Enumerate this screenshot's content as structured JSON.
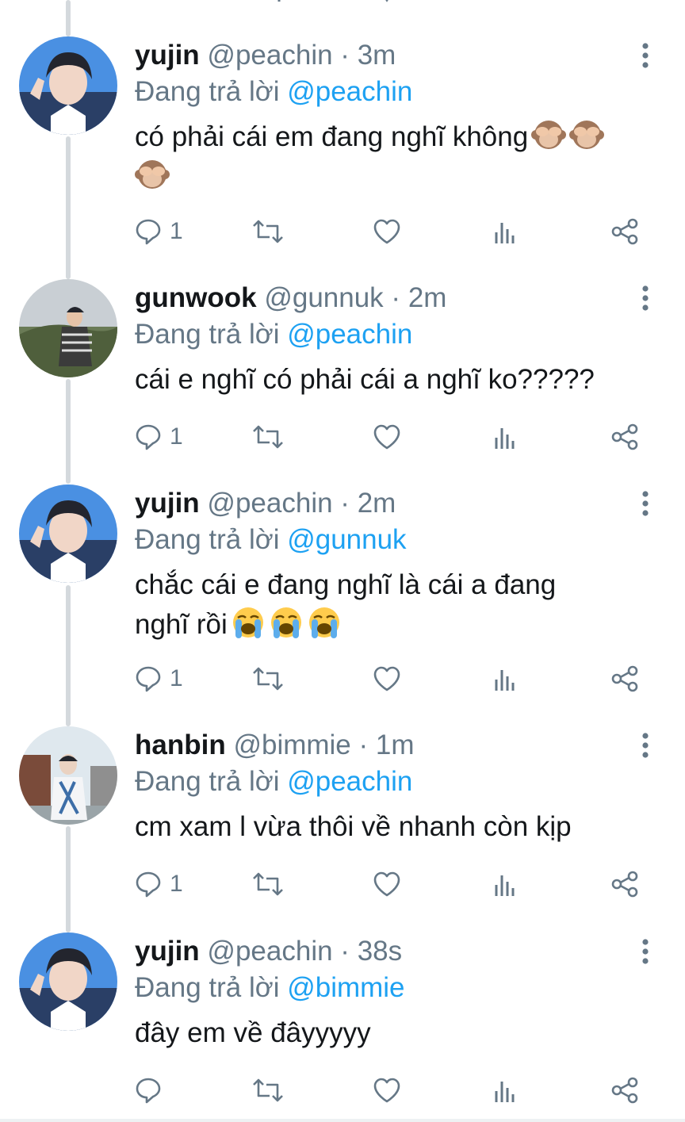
{
  "tweets": [
    {
      "name": "yujin",
      "handle": "@peachin",
      "sep": "·",
      "time": "3m",
      "reply_prefix": "Đang trả lời",
      "reply_to": "@peachin",
      "text": "có phải cái em đang nghĩ không",
      "emoji": [
        "see-no-evil-monkey",
        "see-no-evil-monkey",
        "see-no-evil-monkey"
      ],
      "reply_count": "1"
    },
    {
      "name": "gunwook",
      "handle": "@gunnuk",
      "sep": "·",
      "time": "2m",
      "reply_prefix": "Đang trả lời",
      "reply_to": "@peachin",
      "text": "cái e nghĩ có phải cái a nghĩ ko?????",
      "emoji": [],
      "reply_count": "1"
    },
    {
      "name": "yujin",
      "handle": "@peachin",
      "sep": "·",
      "time": "2m",
      "reply_prefix": "Đang trả lời",
      "reply_to": "@gunnuk",
      "text": "chắc cái e đang nghĩ là cái a đang nghĩ rồi",
      "emoji": [
        "loudly-crying-face",
        "loudly-crying-face",
        "loudly-crying-face"
      ],
      "reply_count": "1"
    },
    {
      "name": "hanbin",
      "handle": "@bimmie",
      "sep": "·",
      "time": "1m",
      "reply_prefix": "Đang trả lời",
      "reply_to": "@peachin",
      "text": "cm xam l vừa thôi về nhanh còn kịp",
      "emoji": [],
      "reply_count": "1"
    },
    {
      "name": "yujin",
      "handle": "@peachin",
      "sep": "·",
      "time": "38s",
      "reply_prefix": "Đang trả lời",
      "reply_to": "@bimmie",
      "text": "đây em về đâyyyyy",
      "emoji": [],
      "reply_count": ""
    }
  ],
  "icons": {
    "reply": "reply-icon",
    "retweet": "retweet-icon",
    "like": "heart-icon",
    "views": "bar-chart-icon",
    "share": "share-icon",
    "more": "more-vertical-icon"
  },
  "colors": {
    "mention": "#1da1f2",
    "muted": "#657786",
    "text": "#14171a",
    "thread": "#d4d9dd"
  }
}
